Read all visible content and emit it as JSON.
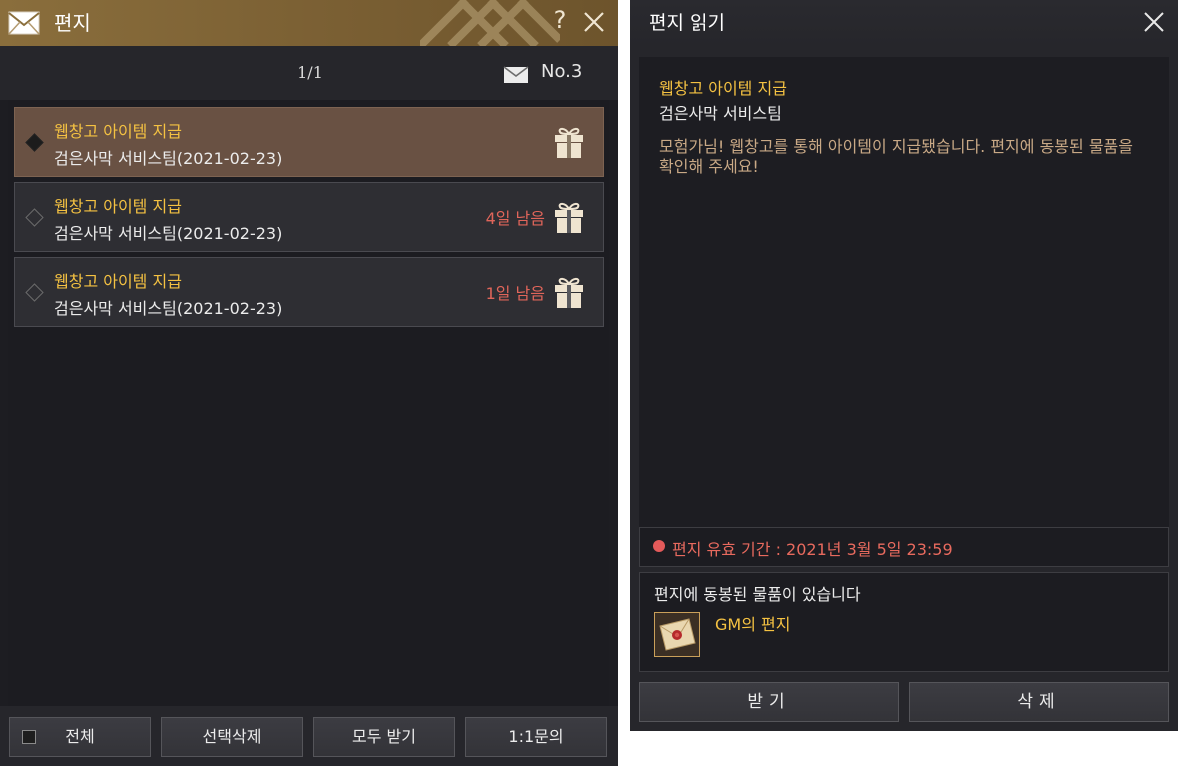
{
  "mailbox": {
    "title": "편지",
    "help_icon": "?",
    "page": "1/1",
    "count": "No.3",
    "items": [
      {
        "subject": "웹창고 아이템 지급",
        "sender": "검은사막 서비스팀(2021-02-23)",
        "remaining": "",
        "selected": true
      },
      {
        "subject": "웹창고 아이템 지급",
        "sender": "검은사막 서비스팀(2021-02-23)",
        "remaining": "4일 남음",
        "selected": false
      },
      {
        "subject": "웹창고 아이템 지급",
        "sender": "검은사막 서비스팀(2021-02-23)",
        "remaining": "1일 남음",
        "selected": false
      }
    ],
    "footer": {
      "select_all": "전체",
      "delete_selected": "선택삭제",
      "receive_all": "모두 받기",
      "inquiry": "1:1문의"
    }
  },
  "reader": {
    "title": "편지 읽기",
    "subject": "웹창고 아이템 지급",
    "sender": "검은사막 서비스팀",
    "message": "모험가님! 웹창고를 통해 아이템이 지급됐습니다. 편지에 동봉된 물품을 확인해 주세요!",
    "validity": "편지 유효 기간 : 2021년 3월 5일 23:59",
    "attachment_header": "편지에 동봉된 물품이 있습니다",
    "attachment_name": "GM의 편지",
    "receive_button": "받기",
    "delete_button": "삭제"
  },
  "colors": {
    "header_gold": "#8a6e3c",
    "subject_yellow": "#f5c242",
    "warning_red": "#e0655a",
    "selected_row": "#695143"
  },
  "icons": [
    "mail-icon",
    "help-icon",
    "close-icon",
    "gift-icon",
    "sealed-letter-icon"
  ]
}
